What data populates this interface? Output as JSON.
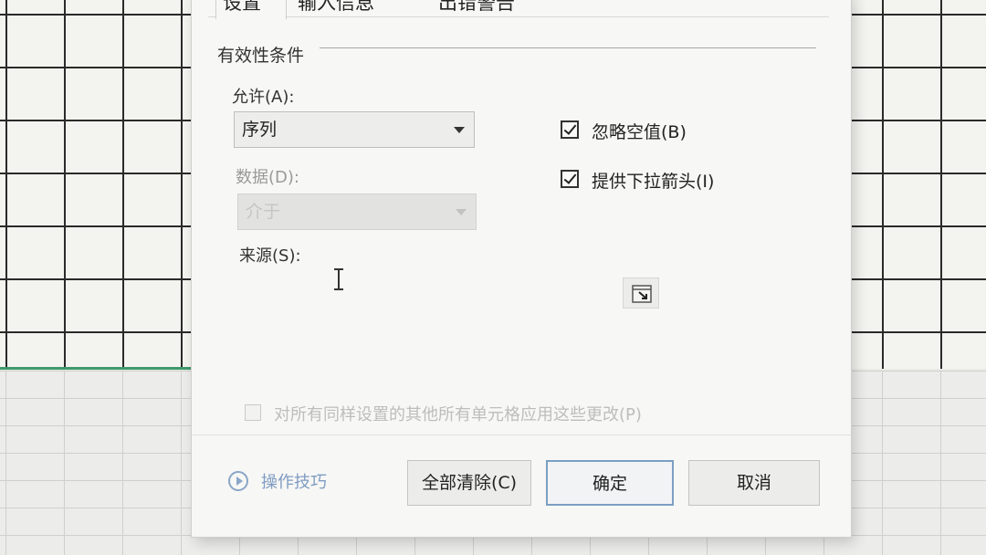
{
  "tabs": [
    {
      "label": "设置"
    },
    {
      "label": "输入信息"
    },
    {
      "label": "出错警告"
    }
  ],
  "group_title": "有效性条件",
  "allow": {
    "label": "允许(A):",
    "value": "序列"
  },
  "data_field": {
    "label": "数据(D):",
    "value": "介于"
  },
  "checkboxes": {
    "ignore_blank": {
      "label": "忽略空值(B)",
      "checked": true
    },
    "dropdown_arrow": {
      "label": "提供下拉箭头(I)",
      "checked": true
    }
  },
  "source": {
    "label": "来源(S):",
    "value": ""
  },
  "apply_all": {
    "label": "对所有同样设置的其他所有单元格应用这些更改(P)",
    "checked": false
  },
  "footer": {
    "tips_label": "操作技巧",
    "clear_label": "全部清除(C)",
    "ok_label": "确定",
    "cancel_label": "取消"
  },
  "colors": {
    "ok_border": "#7a9fc4",
    "link": "#7f9cc2",
    "selection_line": "#3d9a6a"
  }
}
